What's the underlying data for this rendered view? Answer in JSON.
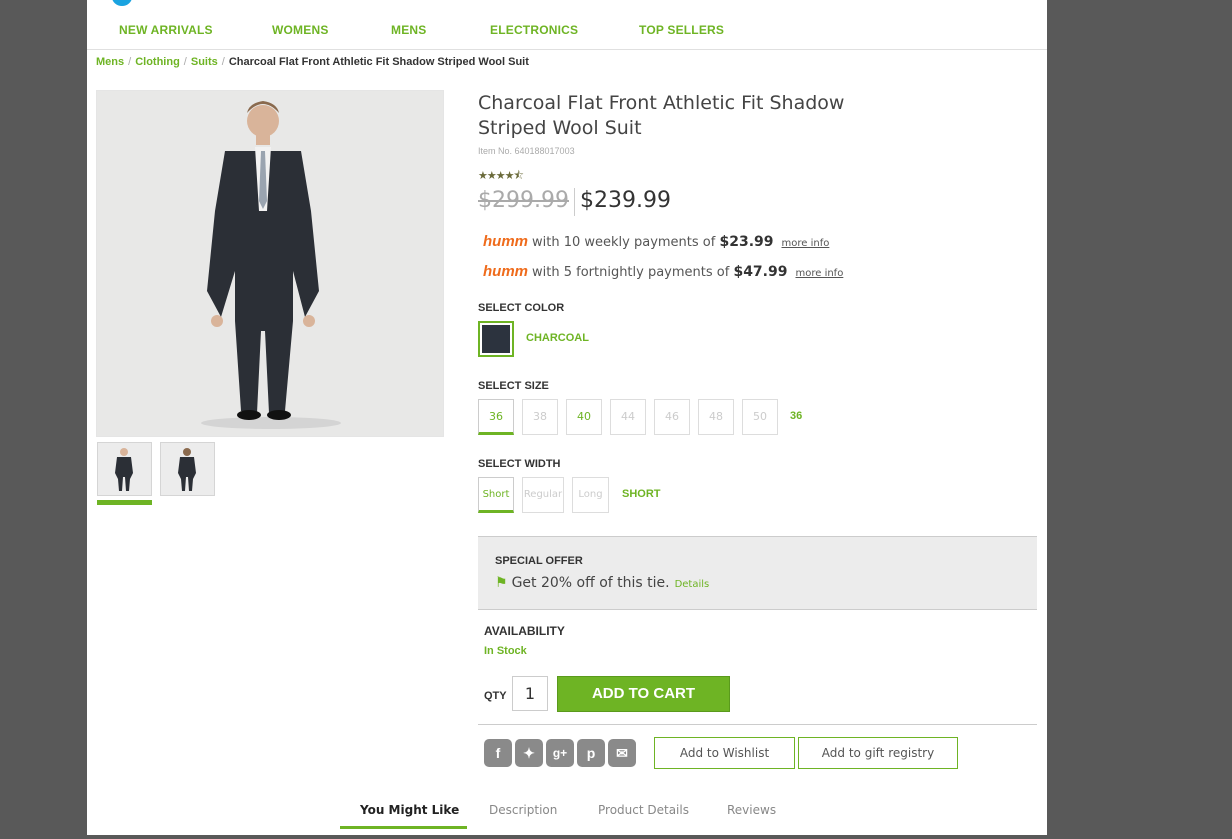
{
  "nav": {
    "items": [
      "NEW ARRIVALS",
      "WOMENS",
      "MENS",
      "ELECTRONICS",
      "TOP SELLERS"
    ]
  },
  "breadcrumb": {
    "links": [
      "Mens",
      "Clothing",
      "Suits"
    ],
    "current": "Charcoal Flat Front Athletic Fit Shadow Striped Wool Suit"
  },
  "product": {
    "title": "Charcoal Flat Front Athletic Fit Shadow Striped Wool Suit",
    "item_no": "Item No. 640188017003",
    "rating_stars": "★★★★⯪",
    "rating": 4.5,
    "old_price": "$299.99",
    "price": "$239.99"
  },
  "humm": [
    {
      "logo": "humm",
      "text": "with 10 weekly payments of",
      "amount": "$23.99",
      "more": "more info"
    },
    {
      "logo": "humm",
      "text": "with 5 fortnightly payments of",
      "amount": "$47.99",
      "more": "more info"
    }
  ],
  "color": {
    "label": "SELECT COLOR",
    "selected": "CHARCOAL",
    "swatch": "#2c333e"
  },
  "size": {
    "label": "SELECT SIZE",
    "options": [
      "36",
      "38",
      "40",
      "44",
      "46",
      "48",
      "50"
    ],
    "selected": "36"
  },
  "width": {
    "label": "SELECT WIDTH",
    "options": [
      "Short",
      "Regular",
      "Long"
    ],
    "selected": "SHORT"
  },
  "offer": {
    "title": "SPECIAL OFFER",
    "text": "Get 20% off of this tie.",
    "details": "Details"
  },
  "availability": {
    "label": "AVAILABILITY",
    "status": "In Stock"
  },
  "cart": {
    "qty_label": "QTY",
    "qty": "1",
    "button": "ADD TO CART"
  },
  "share_icons": [
    "facebook-icon",
    "twitter-icon",
    "google-plus-icon",
    "pinterest-icon",
    "email-icon"
  ],
  "actions": {
    "wishlist": "Add to Wishlist",
    "registry": "Add to gift registry"
  },
  "tabs": [
    "You Might Like",
    "Description",
    "Product Details",
    "Reviews"
  ],
  "colors": {
    "accent": "#6eb424",
    "humm": "#ef6b1b",
    "background": "#595959"
  }
}
